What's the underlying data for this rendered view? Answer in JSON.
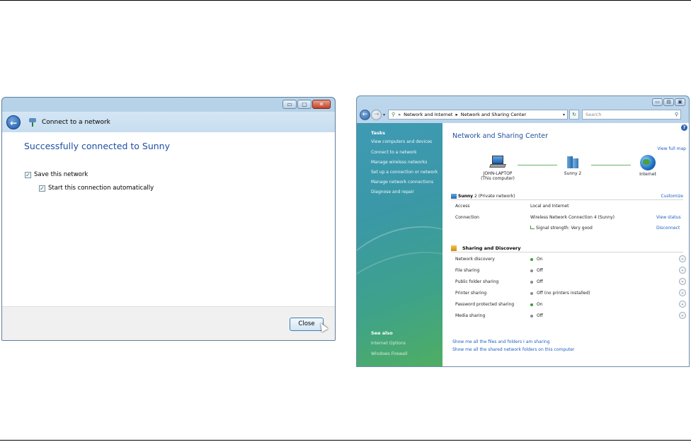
{
  "connect_dialog": {
    "title": "Connect to a network",
    "heading": "Successfully connected to Sunny",
    "save_network": "Save this network",
    "start_automatically": "Start this connection automatically",
    "close_label": "Close",
    "caption_minimize": "▭",
    "caption_maximize": "▢",
    "caption_close": "✕"
  },
  "nsc_window": {
    "caption_minimize": "▭",
    "caption_maximize": "▤",
    "caption_close": "▣",
    "address": {
      "crumb1": "Network and Internet",
      "sep": "▸",
      "crumb2": "Network and Sharing Center",
      "prefix": "«",
      "dropdown": "▾",
      "refresh": "↻"
    },
    "search_placeholder": "Search",
    "sidebar": {
      "tasks_label": "Tasks",
      "tasks": [
        "View computers and devices",
        "Connect to a network",
        "Manage wireless networks",
        "Set up a connection or network",
        "Manage network connections",
        "Diagnose and repair"
      ],
      "see_also_label": "See also",
      "see_also": [
        "Internet Options",
        "Windows Firewall"
      ]
    },
    "main": {
      "title": "Network and Sharing Center",
      "view_full_map": "View full map",
      "help": "?",
      "map": {
        "computer_name": "JOHN-LAPTOP",
        "computer_sub": "(This computer)",
        "network_name": "Sunny 2",
        "internet": "Internet"
      },
      "network": {
        "name": "Sunny",
        "name_suffix": "2 (Private network)",
        "customize": "Customize",
        "access_label": "Access",
        "access_value": "Local and Internet",
        "connection_label": "Connection",
        "connection_value": "Wireless Network Connection 4 (Sunny)",
        "view_status": "View status",
        "signal_value": "Signal strength: Very good",
        "disconnect": "Disconnect"
      },
      "sharing": {
        "title": "Sharing and Discovery",
        "rows": [
          {
            "name": "Network discovery",
            "status": "On",
            "on": true
          },
          {
            "name": "File sharing",
            "status": "Off",
            "on": false
          },
          {
            "name": "Public folder sharing",
            "status": "Off",
            "on": false
          },
          {
            "name": "Printer sharing",
            "status": "Off (no printers installed)",
            "on": false
          },
          {
            "name": "Password protected sharing",
            "status": "On",
            "on": true
          },
          {
            "name": "Media sharing",
            "status": "Off",
            "on": false
          }
        ],
        "expand_glyph": "⌄"
      },
      "links": [
        "Show me all the files and folders I am sharing",
        "Show me all the shared network folders on this computer"
      ]
    }
  }
}
